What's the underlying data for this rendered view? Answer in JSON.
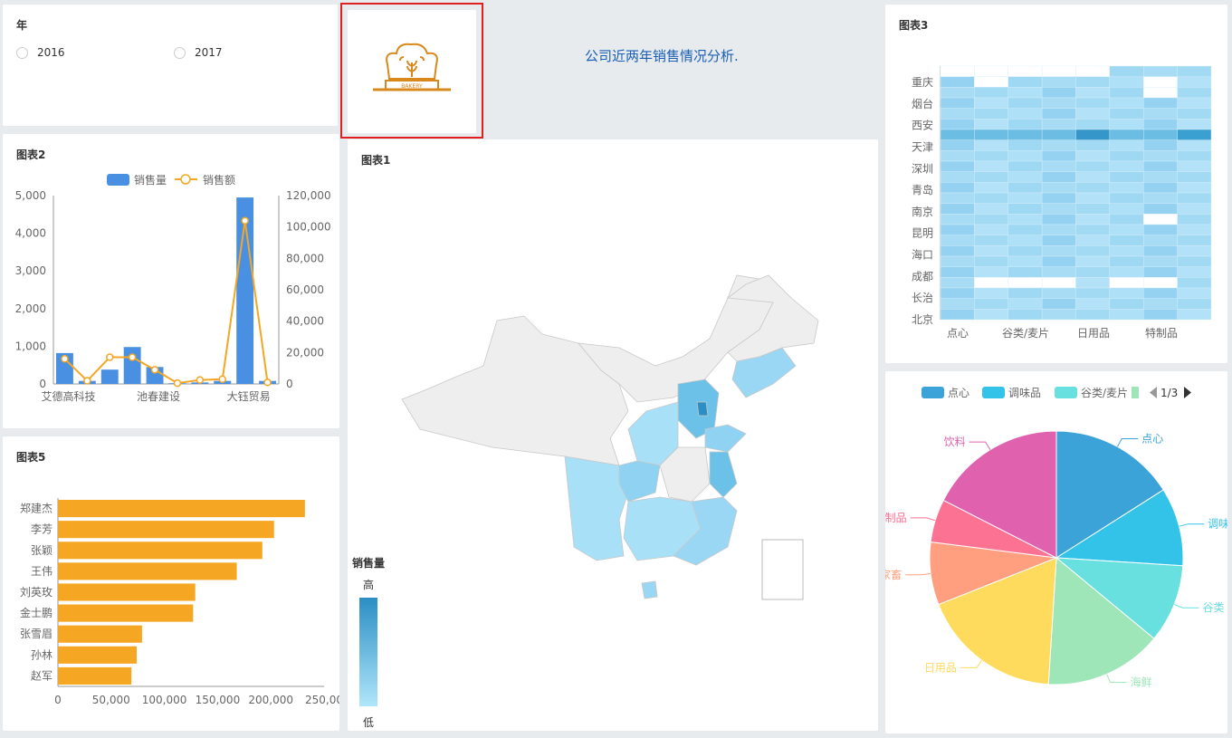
{
  "year_filter": {
    "title": "年",
    "options": [
      "2016",
      "2017"
    ]
  },
  "header": {
    "title": "公司近两年销售情况分析."
  },
  "logo": {
    "text": "BAKERY"
  },
  "chart2": {
    "title": "图表2"
  },
  "chart1": {
    "title": "图表1",
    "legend_title": "销售量",
    "high": "高",
    "low": "低"
  },
  "chart3": {
    "title": "图表3"
  },
  "chart5": {
    "title": "图表5"
  },
  "pie": {
    "page": "1/3"
  },
  "colors": {
    "bar_blue": "#4a90e2",
    "line_orange": "#f5a623",
    "hbar_orange": "#f5a623",
    "heat_base": "#a8dcf5",
    "map_blue": "#9ad7f5",
    "map_gray": "#eeeeee"
  },
  "chart_data": [
    {
      "type": "bar",
      "id": "chart2",
      "categories": [
        "艾德高科技",
        "",
        "",
        "",
        "池春建设",
        "",
        "",
        "",
        "大钰贸易",
        ""
      ],
      "x_tick_labels": [
        "艾德高科技",
        "池春建设",
        "大钰贸易"
      ],
      "series": [
        {
          "name": "销售量",
          "values": [
            820,
            80,
            380,
            980,
            450,
            20,
            40,
            80,
            4950,
            80
          ],
          "axis": "left"
        },
        {
          "name": "销售额",
          "values": [
            16000,
            2000,
            17000,
            17000,
            9000,
            500,
            2500,
            3000,
            104000,
            1000
          ],
          "axis": "right"
        }
      ],
      "ylim_left": [
        0,
        5000
      ],
      "yticks_left": [
        "0",
        "1,000",
        "2,000",
        "3,000",
        "4,000",
        "5,000"
      ],
      "ylim_right": [
        0,
        120000
      ],
      "yticks_right": [
        "0",
        "20,000",
        "40,000",
        "60,000",
        "80,000",
        "100,000",
        "120,000"
      ],
      "legend": "top"
    },
    {
      "type": "heatmap",
      "id": "chart3",
      "y_labels": [
        "重庆",
        "烟台",
        "西安",
        "天津",
        "深圳",
        "青岛",
        "南京",
        "昆明",
        "海口",
        "成都",
        "长治",
        "北京"
      ],
      "x_labels": [
        "点心",
        "谷类/麦片",
        "日用品",
        "特制品"
      ],
      "rows": 24,
      "cols": 8
    },
    {
      "type": "bar",
      "id": "chart5",
      "orientation": "horizontal",
      "categories": [
        "郑建杰",
        "李芳",
        "张颖",
        "王伟",
        "刘英玫",
        "金士鹏",
        "张雪眉",
        "孙林",
        "赵军"
      ],
      "values": [
        232000,
        203000,
        192000,
        168000,
        129000,
        127000,
        79000,
        74000,
        69000
      ],
      "xlim": [
        0,
        250000
      ],
      "xticks": [
        "0",
        "50,000",
        "100,000",
        "150,000",
        "200,000",
        "250,00"
      ]
    },
    {
      "type": "pie",
      "id": "pie",
      "legend": [
        "点心",
        "调味品",
        "谷类/麦片"
      ],
      "slices": [
        {
          "label": "点心",
          "value": 16,
          "color": "#3ba3d8"
        },
        {
          "label": "调味",
          "value": 10,
          "color": "#34c3e8"
        },
        {
          "label": "谷类",
          "value": 10,
          "color": "#69e0e0"
        },
        {
          "label": "海鲜",
          "value": 15,
          "color": "#9ee6b8"
        },
        {
          "label": "日用品",
          "value": 18,
          "color": "#fedb5c"
        },
        {
          "label": "家畜",
          "value": 8,
          "color": "#ff9f7f"
        },
        {
          "label": "制品",
          "value": 5.5,
          "color": "#fb7293"
        },
        {
          "label": "饮料",
          "value": 17.5,
          "color": "#e062ae"
        }
      ]
    },
    {
      "type": "map",
      "id": "chart1",
      "legend": "销售量"
    }
  ]
}
